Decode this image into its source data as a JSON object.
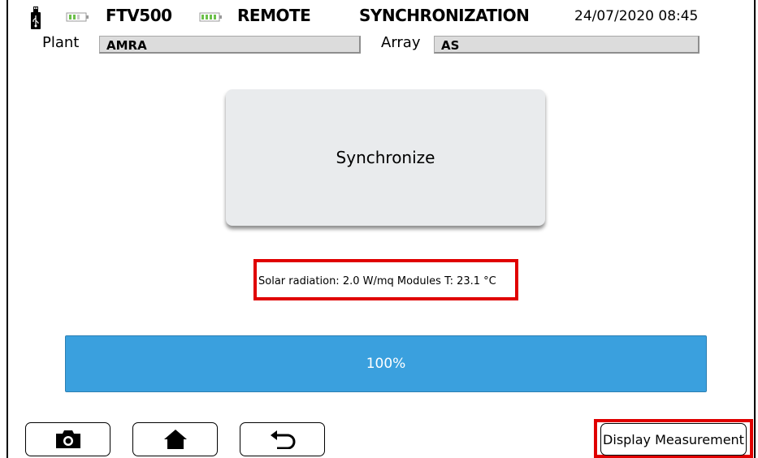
{
  "status_bar": {
    "usb_icon": "usb-stick-icon",
    "device_battery_icon": "battery-icon",
    "device": "FTV500",
    "remote_battery_icon": "battery-icon",
    "mode": "REMOTE",
    "screen": "SYNCHRONIZATION",
    "datetime": "24/07/2020 08:45"
  },
  "info": {
    "plant_label": "Plant",
    "plant_value": "AMRA",
    "array_label": "Array",
    "array_value": "AS"
  },
  "main": {
    "sync_button_label": "Synchronize",
    "readout": "Solar radiation: 2.0 W/mq  Modules T: 23.1 °C",
    "progress_text": "100%",
    "progress_fraction": 1.0
  },
  "footer": {
    "camera_icon": "camera-icon",
    "home_icon": "home-icon",
    "back_icon": "back-arrow-icon",
    "display_label": "Display Measurement"
  },
  "colors": {
    "progress": "#3aa0de",
    "highlight": "#e00000",
    "battery": "#6cc04a"
  }
}
